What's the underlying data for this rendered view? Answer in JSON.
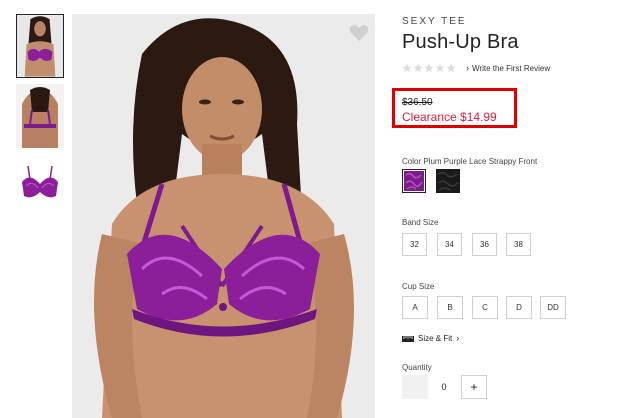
{
  "product": {
    "brand": "SEXY TEE",
    "title": "Push-Up Bra",
    "review_link": "Write the First Review",
    "rating_stars": 0,
    "price_original": "$36.50",
    "price_sale": "Clearance $14.99"
  },
  "colors": {
    "label": "Color Plum Purple Lace Strappy Front",
    "swatches": [
      "plum-purple-lace",
      "black-lace"
    ]
  },
  "band": {
    "label": "Band Size",
    "options": [
      "32",
      "34",
      "36",
      "38"
    ]
  },
  "cup": {
    "label": "Cup Size",
    "options": [
      "A",
      "B",
      "C",
      "D",
      "DD"
    ]
  },
  "size_fit": {
    "label": "Size & Fit"
  },
  "quantity": {
    "label": "Quantity",
    "value": "0",
    "plus": "+"
  },
  "icons": {
    "heart": "heart-icon",
    "star": "star-icon",
    "ruler": "ruler-icon",
    "chevron": "chevron-right-icon"
  },
  "palette": {
    "sale_red": "#e0193d",
    "highlight_red": "#e00000",
    "bra_purple": "#8b1f9a",
    "border_gray": "#cfcfcf"
  }
}
